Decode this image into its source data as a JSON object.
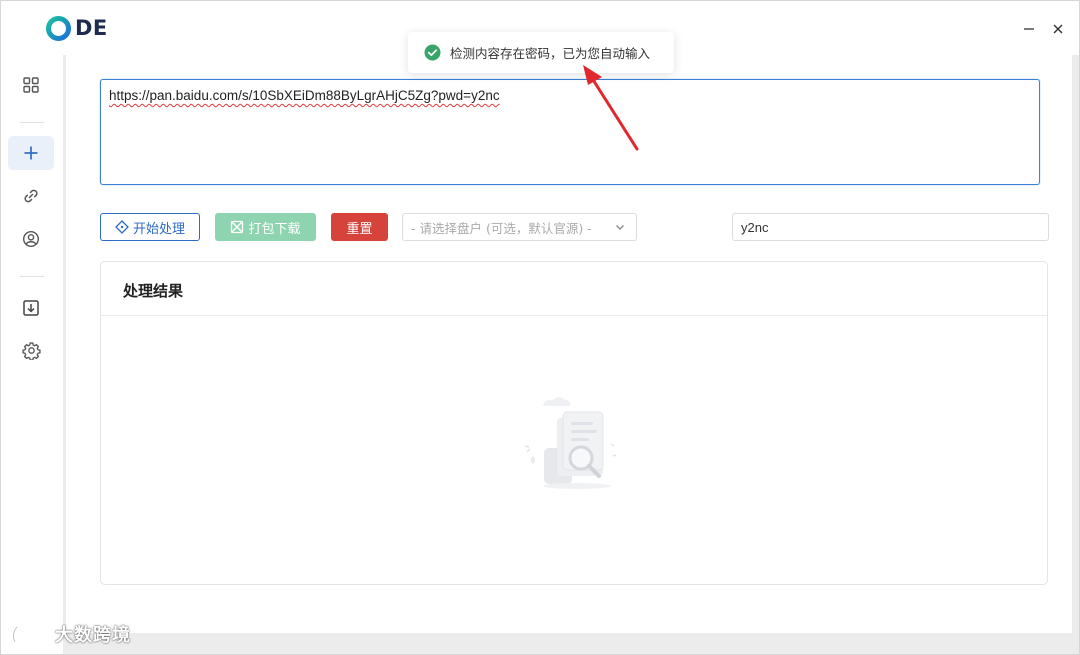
{
  "app": {
    "logo_text": "DE"
  },
  "window_controls": {
    "minimize": "—",
    "close": "×"
  },
  "sidebar": {
    "items": [
      {
        "icon": "grid-icon"
      },
      {
        "icon": "plus-icon",
        "active": true
      },
      {
        "icon": "link-icon"
      },
      {
        "icon": "user-icon"
      },
      {
        "icon": "download-icon"
      },
      {
        "icon": "gear-icon"
      }
    ]
  },
  "url_input": {
    "value": "https://pan.baidu.com/s/10SbXEiDm88ByLgrAHjC5Zg?pwd=y2nc"
  },
  "toolbar": {
    "start_label": "开始处理",
    "pack_label": "打包下载",
    "reset_label": "重置",
    "disk_select_placeholder": "- 请选择盘户 (可选，默认官源) -",
    "password_value": "y2nc"
  },
  "result": {
    "title": "处理结果"
  },
  "toast": {
    "message": "检测内容存在密码，已为您自动输入",
    "status": "success"
  },
  "watermark": {
    "text": "大数跨境"
  },
  "colors": {
    "primary": "#2d6bc4",
    "success": "#3aa56a",
    "danger": "#d6433b",
    "pack_disabled": "#8fd4b0",
    "annotation_arrow": "#e0282e"
  }
}
